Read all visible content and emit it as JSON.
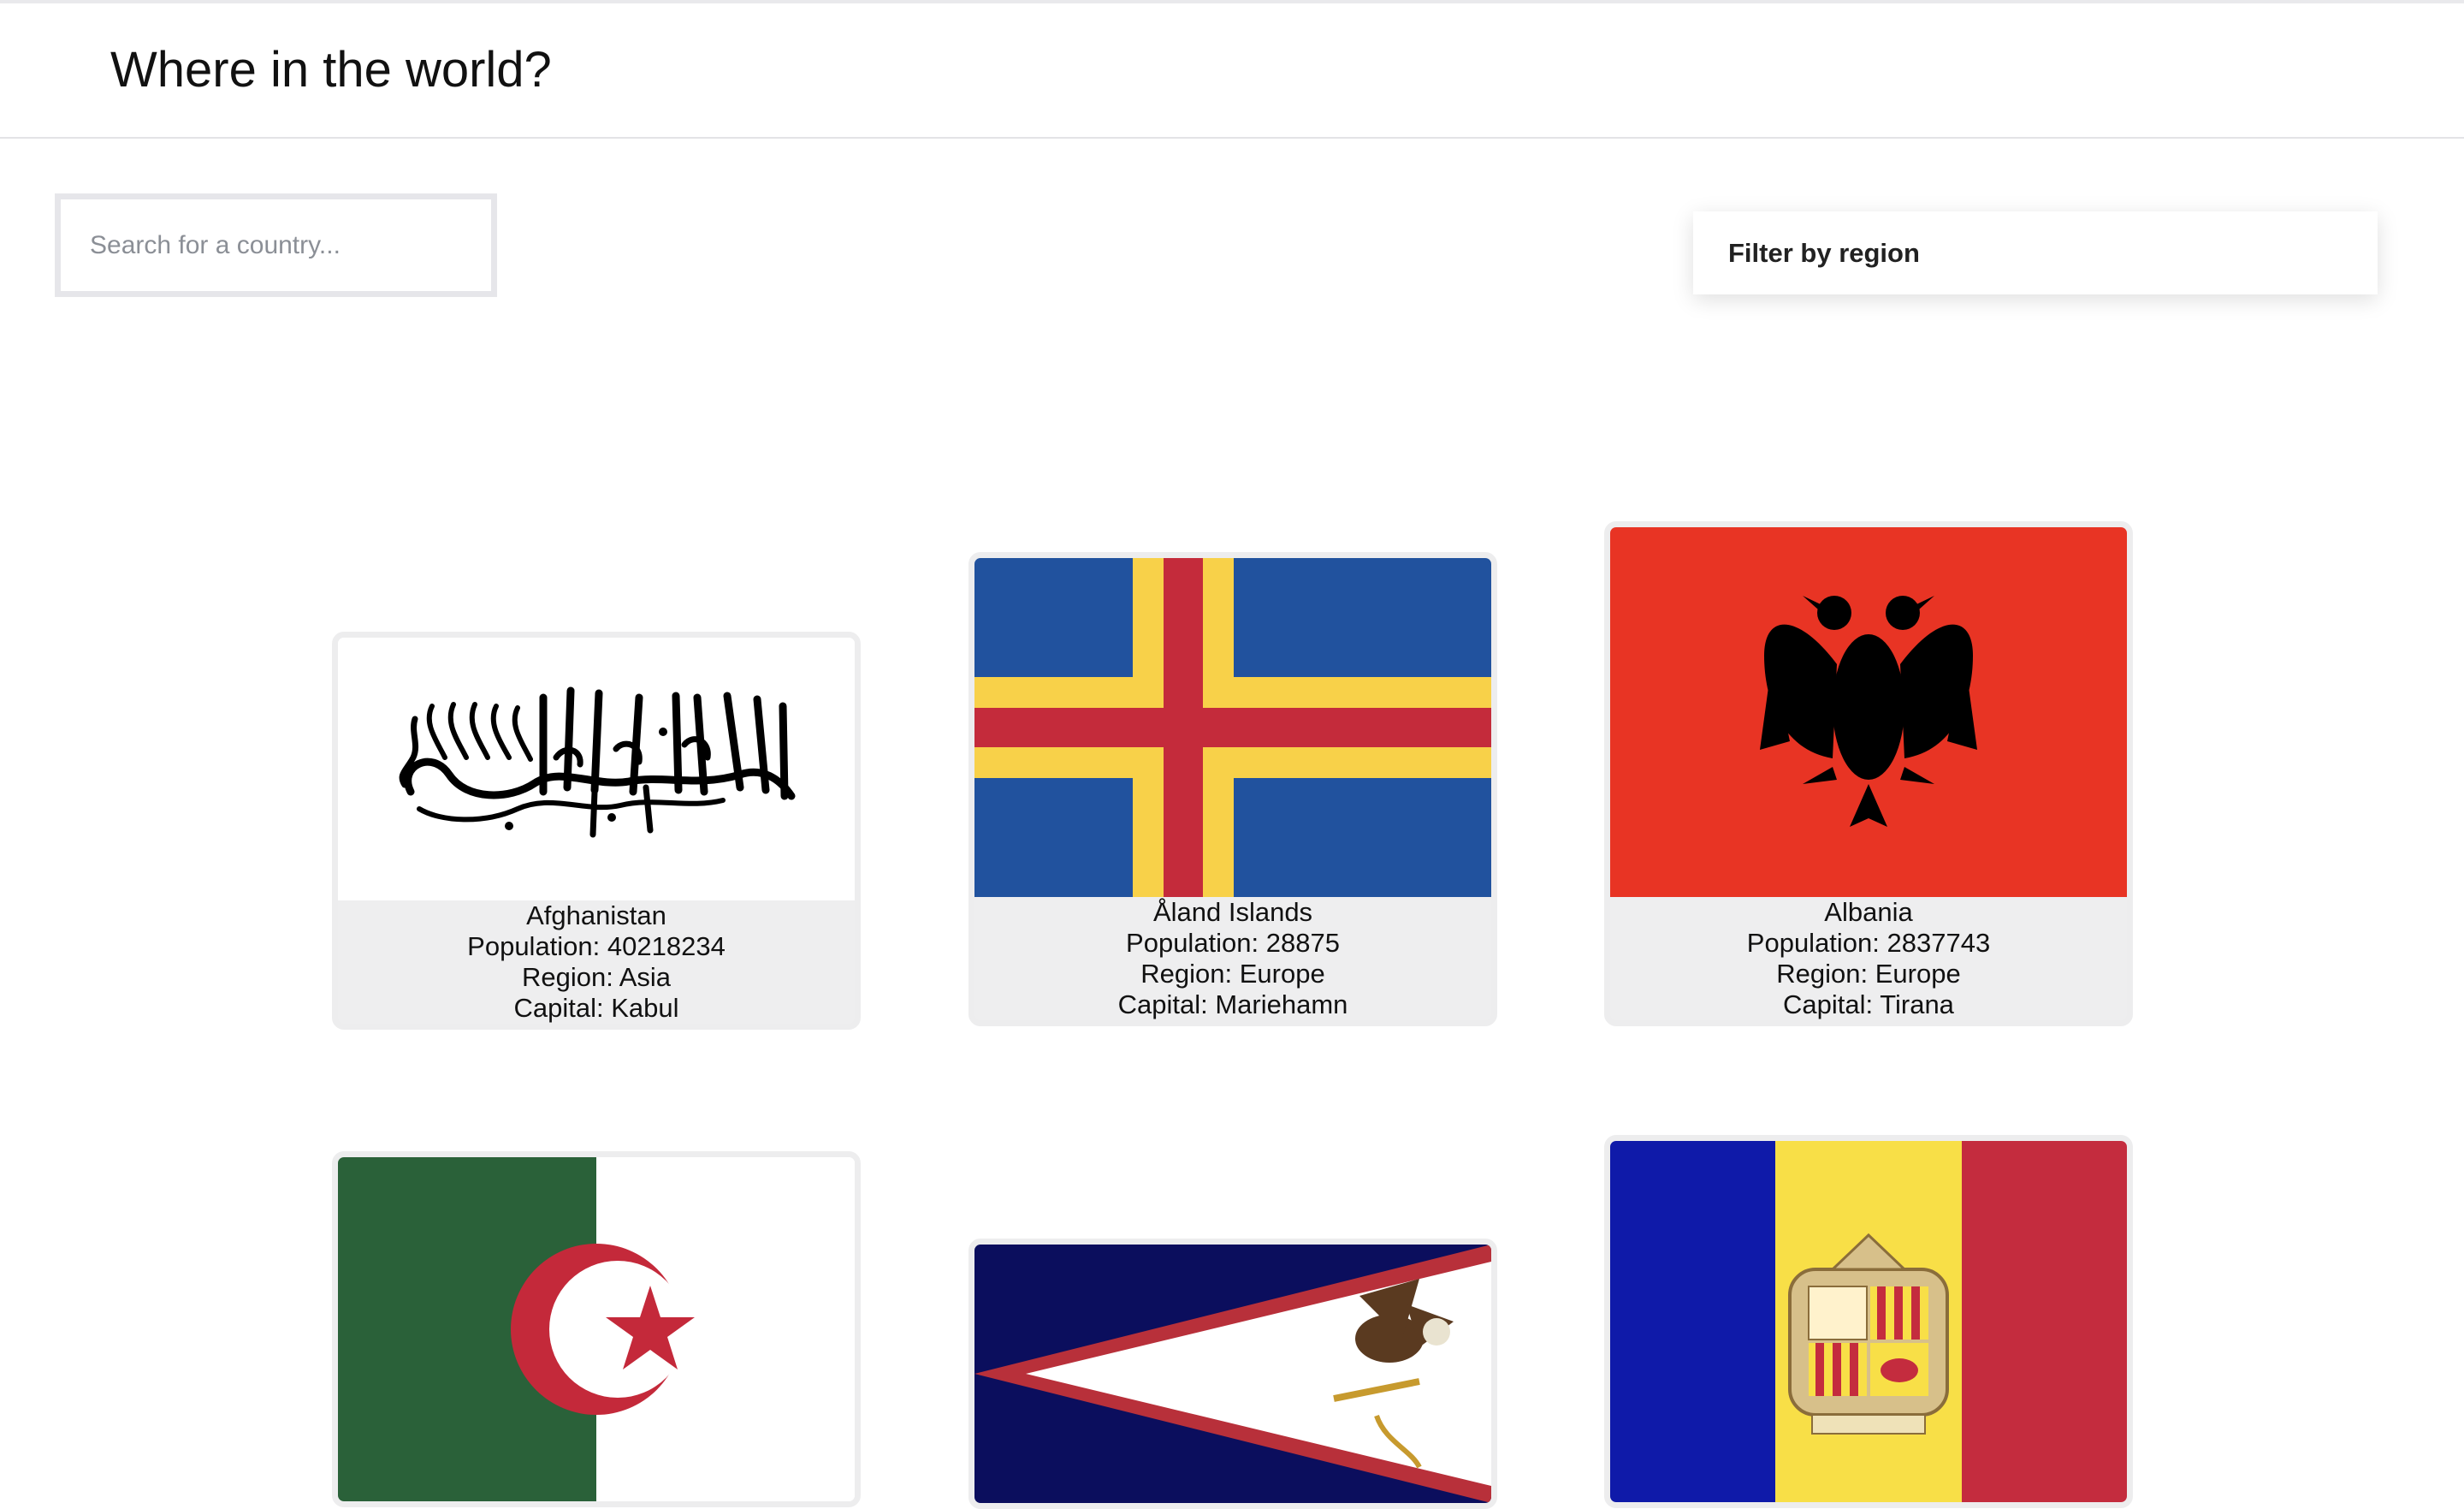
{
  "header": {
    "title": "Where in the world?"
  },
  "search": {
    "placeholder": "Search for a country..."
  },
  "filter": {
    "label": "Filter by region"
  },
  "countries": [
    {
      "name": "Afghanistan",
      "population": "Population: 40218234",
      "region": "Region: Asia",
      "capital": "Capital: Kabul",
      "flag_icon": "afghanistan-flag"
    },
    {
      "name": "Åland Islands",
      "population": "Population: 28875",
      "region": "Region: Europe",
      "capital": "Capital: Mariehamn",
      "flag_icon": "aland-islands-flag"
    },
    {
      "name": "Albania",
      "population": "Population: 2837743",
      "region": "Region: Europe",
      "capital": "Capital: Tirana",
      "flag_icon": "albania-flag"
    },
    {
      "flag_icon": "algeria-flag"
    },
    {
      "flag_icon": "american-samoa-flag"
    },
    {
      "flag_icon": "andorra-flag"
    }
  ],
  "colors": {
    "aland_blue": "#21529e",
    "aland_yellow": "#f8d149",
    "aland_red": "#c42b3b",
    "albania_red": "#e83424",
    "algeria_green": "#2a6139",
    "algeria_red": "#c4293a",
    "samoa_navy": "#0b0e5d",
    "samoa_red": "#b8303a",
    "andorra_blue": "#0f1aa9",
    "andorra_yellow": "#f8df47",
    "andorra_red": "#c42c3e"
  }
}
